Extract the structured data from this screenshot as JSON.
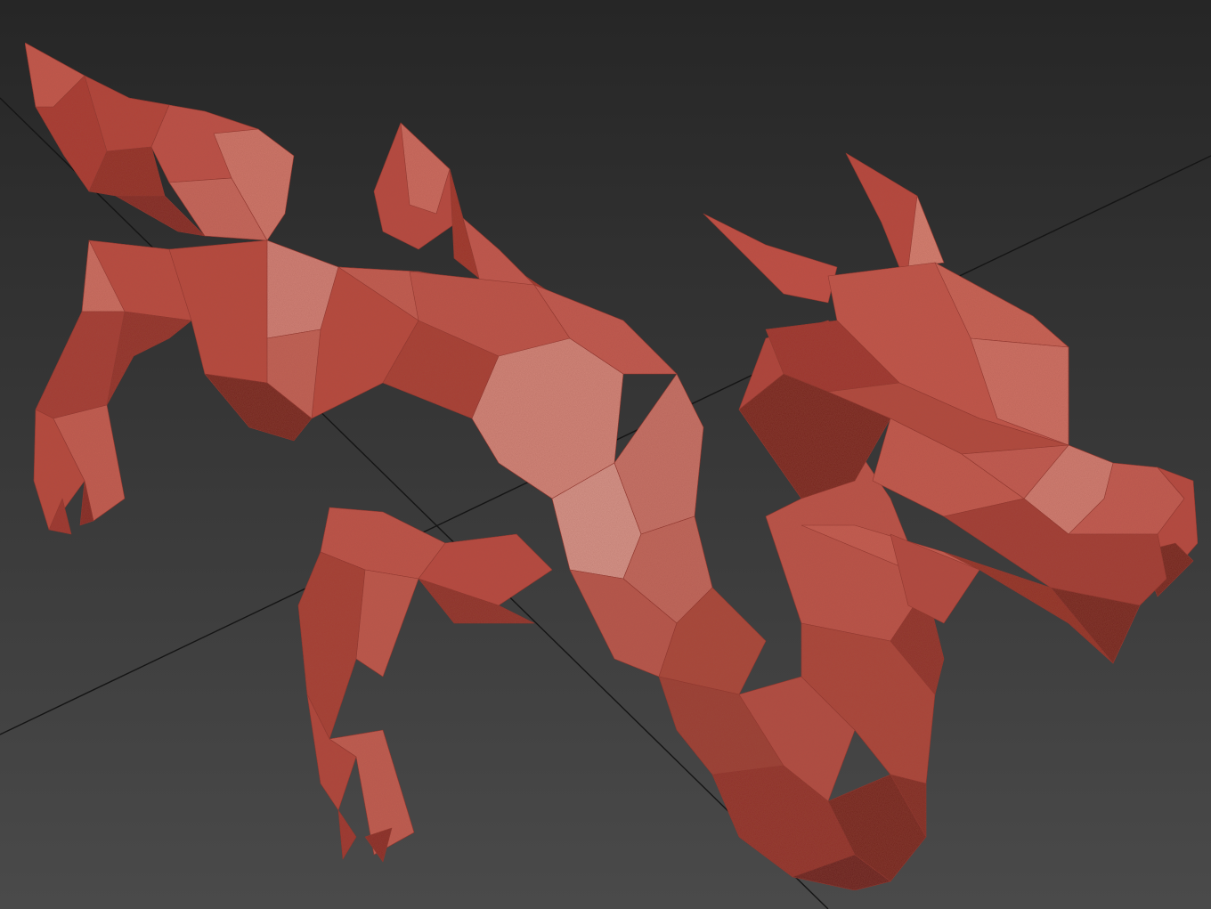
{
  "viewport": {
    "background_top": "#262626",
    "background_bottom": "#4a4a4a",
    "grid_line_color": "#1a1a1a",
    "model": {
      "name": "dragon",
      "style": "low-poly",
      "base_color": "#b8453c",
      "highlight_color": "#d98878",
      "shadow_color": "#6e1f1a",
      "deep_shadow_color": "#4a1410"
    }
  }
}
